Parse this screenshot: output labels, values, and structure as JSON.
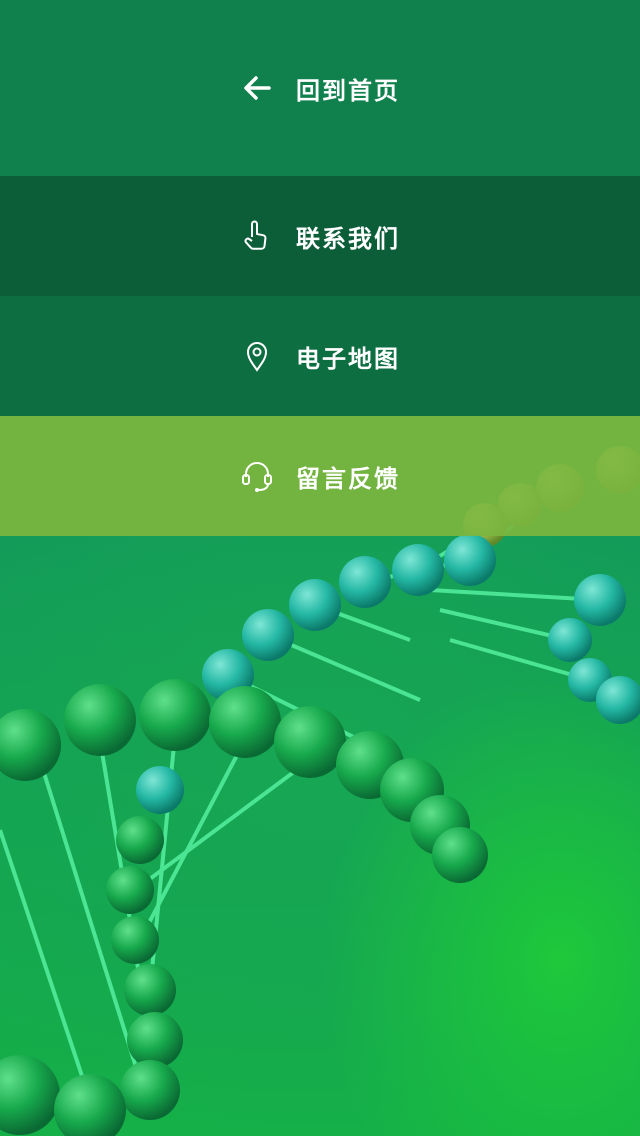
{
  "menu": {
    "items": [
      {
        "id": "home",
        "label": "回到首页",
        "icon": "arrow-left-icon"
      },
      {
        "id": "contact",
        "label": "联系我们",
        "icon": "pointing-hand-icon"
      },
      {
        "id": "map",
        "label": "电子地图",
        "icon": "location-pin-icon"
      },
      {
        "id": "feedback",
        "label": "留言反馈",
        "icon": "headset-icon"
      }
    ]
  },
  "colors": {
    "home_bg": "#10804c",
    "contact_bg": "#0c5c38",
    "map_bg": "#0d6c40",
    "feedback_bg": "#7bb640",
    "background_green": "#15b048"
  }
}
